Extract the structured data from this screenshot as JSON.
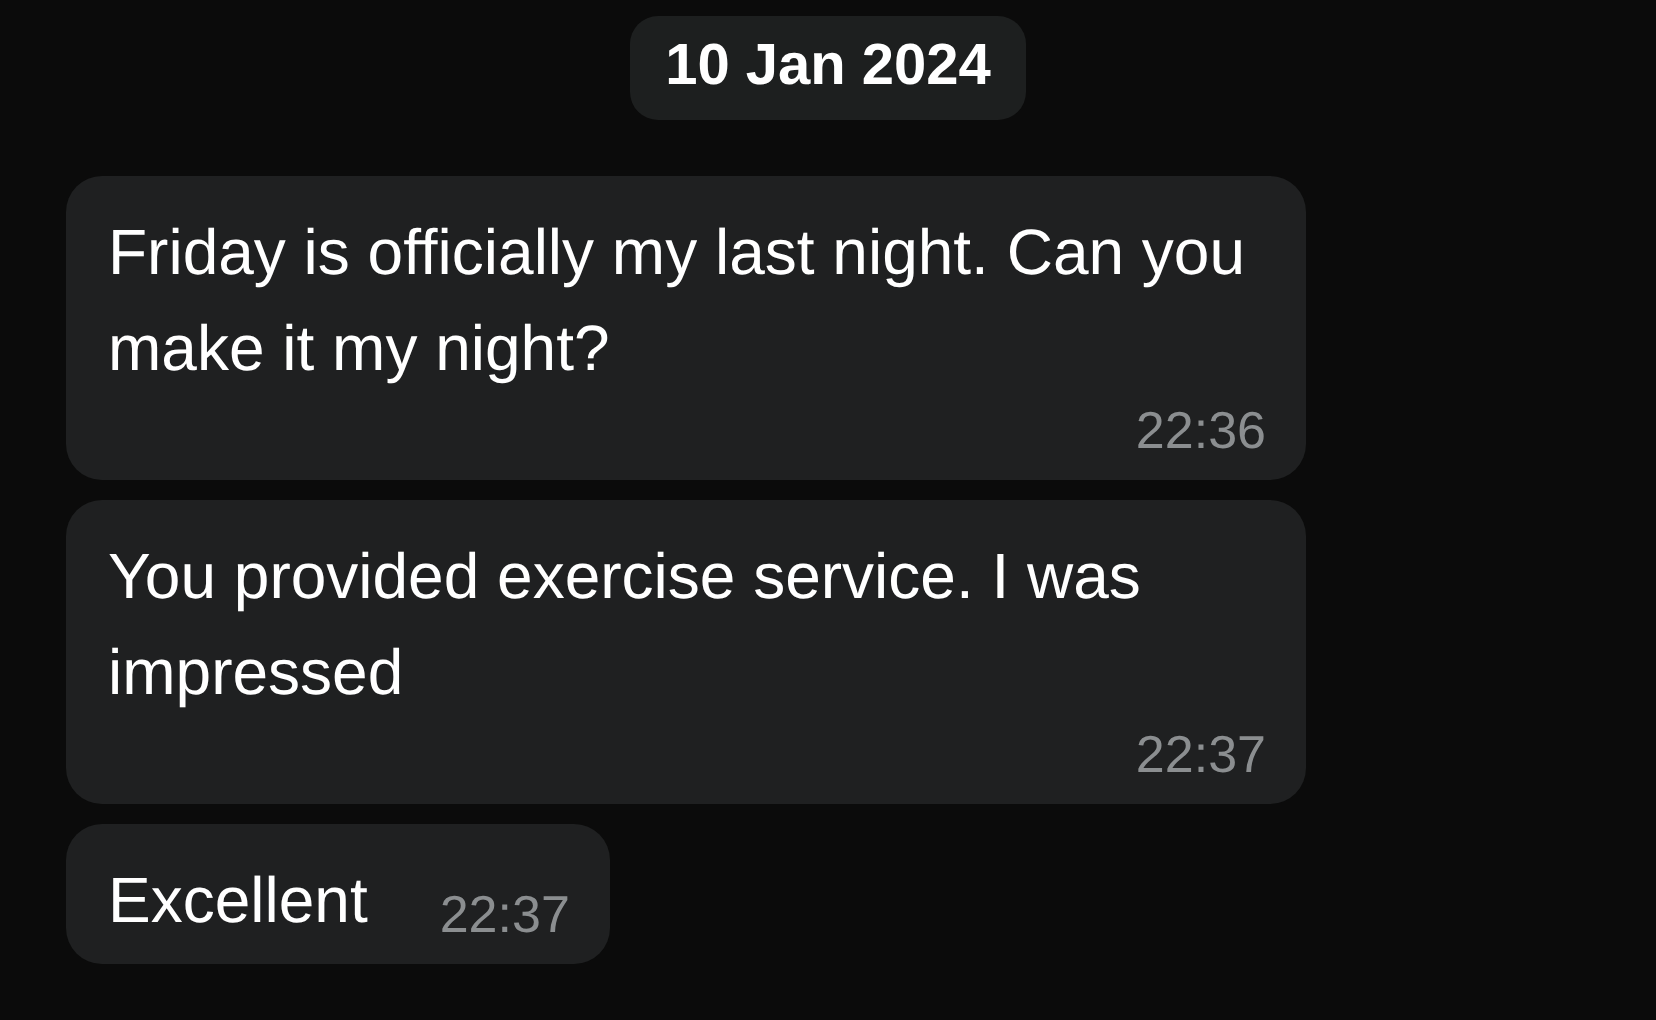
{
  "date_separator": "10 Jan 2024",
  "messages": [
    {
      "text": "Friday is officially my last night. Can you make it my night?",
      "time": "22:36"
    },
    {
      "text": "You provided exercise service. I was impressed",
      "time": "22:37"
    },
    {
      "text": "Excellent",
      "time": "22:37"
    }
  ]
}
